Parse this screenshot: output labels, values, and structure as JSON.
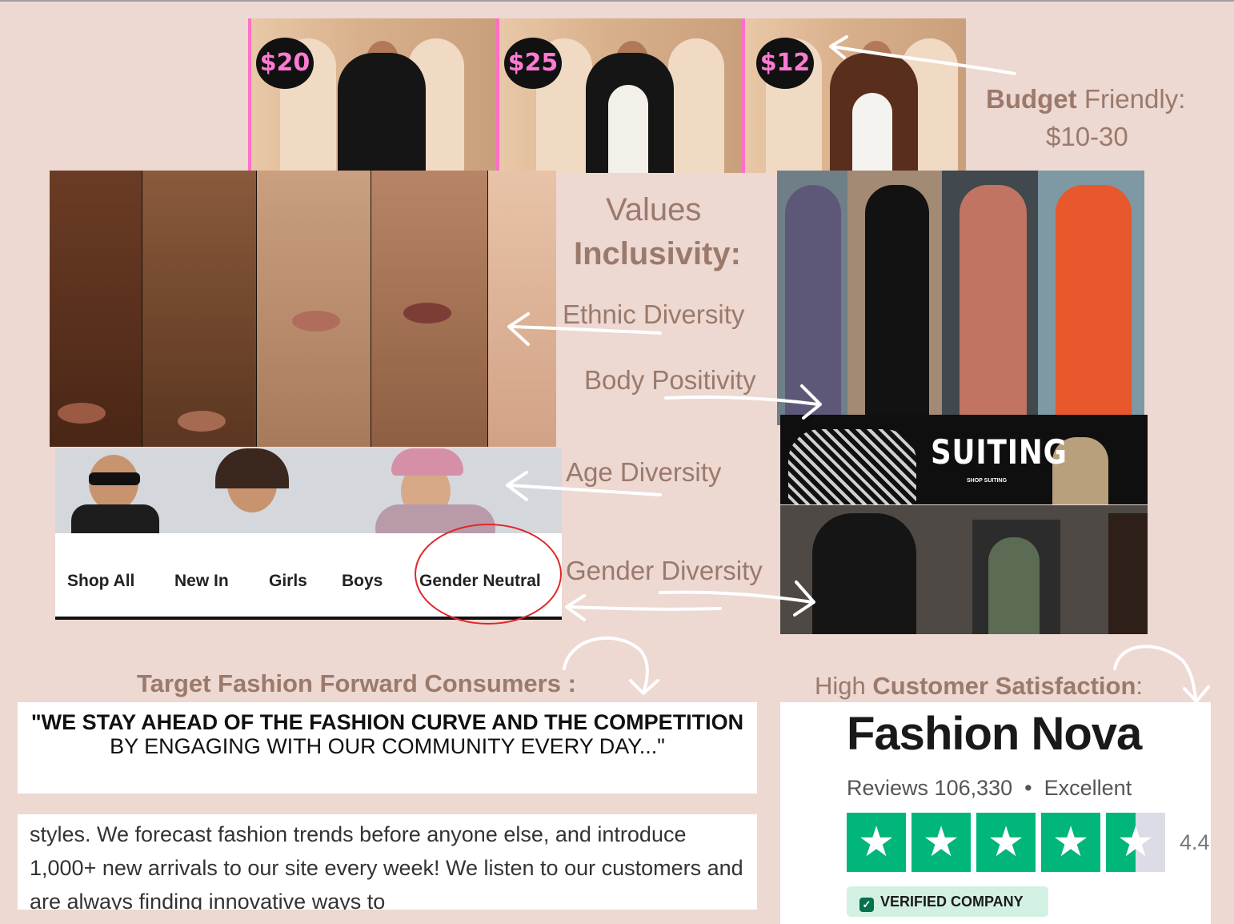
{
  "prices": [
    "$20",
    "$25",
    "$12"
  ],
  "budget": {
    "bold": "Budget",
    "rest": " Friendly:",
    "range": "$10-30"
  },
  "values": {
    "line1": "Values",
    "line2": "Inclusivity:"
  },
  "labels": {
    "ethnic": "Ethnic Diversity",
    "body": "Body Positivity",
    "age": "Age Diversity",
    "gender": "Gender Diversity"
  },
  "kids_nav": [
    "Shop All",
    "New In",
    "Girls",
    "Boys",
    "Gender Neutral"
  ],
  "suiting": {
    "title": "SUITING",
    "sub": "SHOP SUITING"
  },
  "target": {
    "heading": "Target Fashion Forward Consumers :"
  },
  "quote": {
    "bold_part": "\"WE STAY AHEAD OF THE FASHION CURVE AND THE COMPETITION",
    "rest": " BY ENGAGING WITH OUR COMMUNITY EVERY DAY...\""
  },
  "about": "styles. We forecast fashion trends before anyone else, and introduce 1,000+ new arrivals to our site every week! We listen to our customers and are always finding innovative ways to",
  "satisfaction": {
    "prefix": "High ",
    "bold": "Customer Satisfaction",
    "suffix": ":"
  },
  "trustpilot": {
    "company": "Fashion Nova",
    "reviews_label": "Reviews",
    "reviews_count": "106,330",
    "separator": "•",
    "rating_word": "Excellent",
    "score": "4.4",
    "verified": "VERIFIED COMPANY",
    "stars": 4.4
  },
  "colors": {
    "background": "#edd8d2",
    "annotation_text": "#9b7a6b",
    "price_badge_text": "#ff7ad2",
    "trustpilot_green": "#00b67a",
    "highlight_oval": "#e0262a"
  }
}
